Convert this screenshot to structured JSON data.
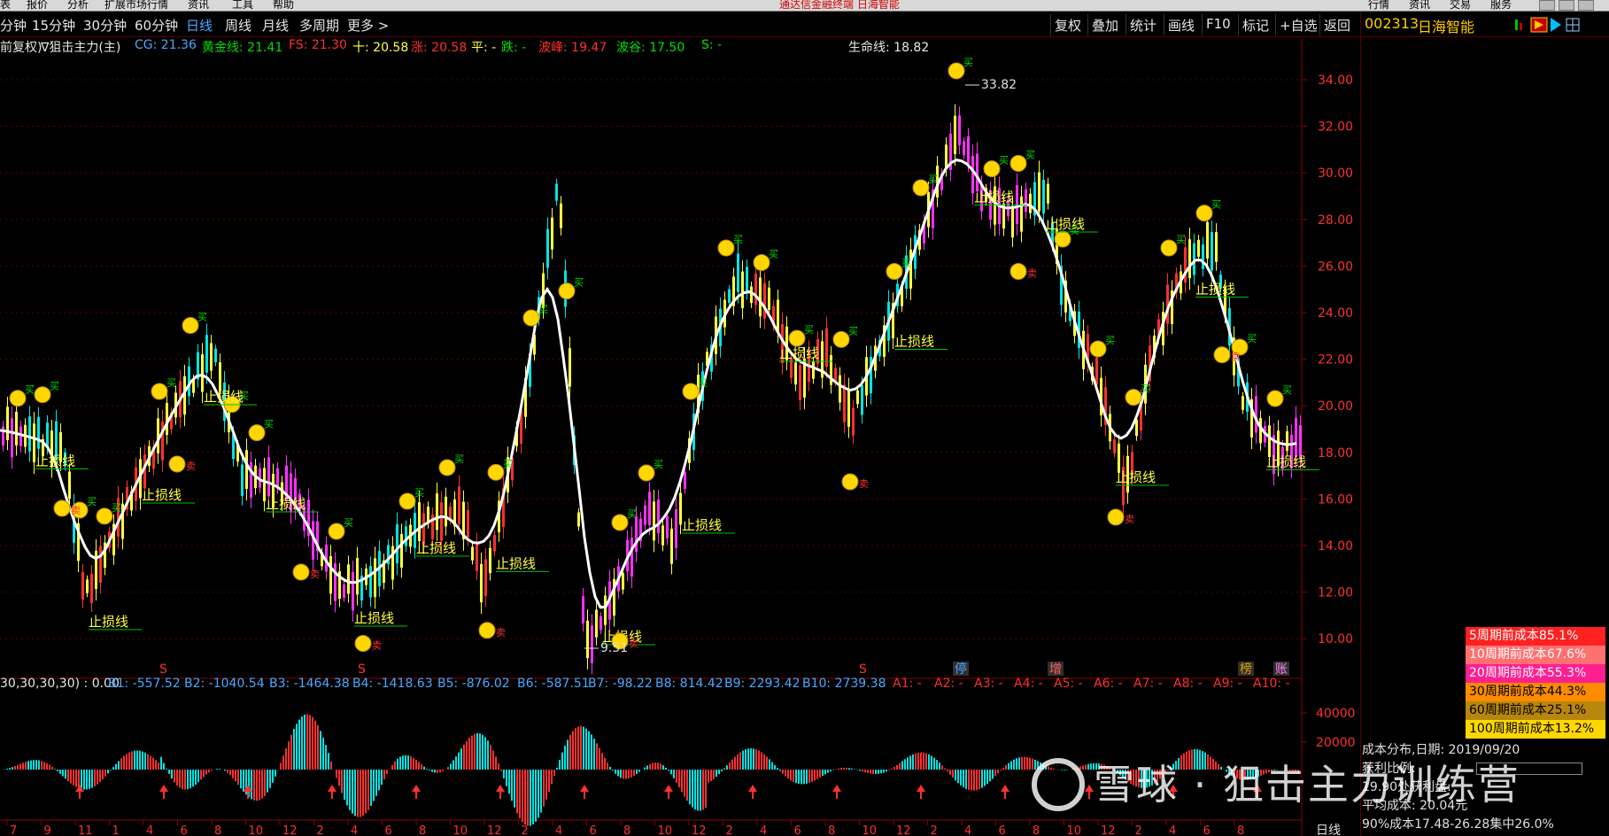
{
  "menu": {
    "items": [
      "表",
      "报价",
      "分析",
      "扩展市场行情",
      "资讯",
      "工具",
      "帮助"
    ],
    "app_title": "通达信金融终端 日海智能",
    "right_items": [
      "行情",
      "资讯",
      "交易",
      "服务"
    ]
  },
  "periods": {
    "items": [
      "分钟",
      "15分钟",
      "30分钟",
      "60分钟",
      "日线",
      "周线",
      "月线",
      "多周期",
      "更多 >"
    ],
    "active": "日线"
  },
  "toolbar": [
    "复权",
    "叠加",
    "统计",
    "画线",
    "F10",
    "标记",
    "+自选",
    "返回"
  ],
  "stock": {
    "code": "002313",
    "name": "日海智能"
  },
  "indicator": {
    "mode": "前复权",
    "name": "∇狙击主力(主)",
    "values": [
      {
        "label": "CG: 21.36",
        "color": "#4aa8ff"
      },
      {
        "label": "黄金线: 21.41",
        "color": "#00e000"
      },
      {
        "label": "FS: 21.30",
        "color": "#ff3030"
      },
      {
        "label": "十: 20.58",
        "color": "#ffff40"
      },
      {
        "label": "涨: 20.58",
        "color": "#ff3030"
      },
      {
        "label": "平: -",
        "color": "#ffff40"
      },
      {
        "label": "跌: -",
        "color": "#00e000"
      },
      {
        "label": "波峰: 19.47",
        "color": "#ff3030"
      },
      {
        "label": "波谷: 17.50",
        "color": "#00e000"
      },
      {
        "label": "S: -",
        "color": "#00e000"
      }
    ],
    "lifeline": "生命线: 18.82"
  },
  "price_axis": [
    "34.00",
    "32.00",
    "30.00",
    "28.00",
    "26.00",
    "24.00",
    "22.00",
    "20.00",
    "18.00",
    "16.00",
    "14.00",
    "12.00",
    "10.00"
  ],
  "annotations": {
    "high": "33.82",
    "low": "9.51",
    "stop_loss": "止损线",
    "sell": "卖",
    "buy": "买"
  },
  "event_markers": [
    "S",
    "S",
    "S",
    "停",
    "增",
    "榜",
    "账"
  ],
  "oscillator": {
    "params": "30,30,30,30) : 0.00",
    "values": [
      {
        "label": "B1: -557.52",
        "color": "#4aa8ff"
      },
      {
        "label": "B2: -1040.54",
        "color": "#4aa8ff"
      },
      {
        "label": "B3: -1464.38",
        "color": "#4aa8ff"
      },
      {
        "label": "B4: -1418.63",
        "color": "#4aa8ff"
      },
      {
        "label": "B5: -876.02",
        "color": "#4aa8ff"
      },
      {
        "label": "B6: -587.51",
        "color": "#4aa8ff"
      },
      {
        "label": "B7: -98.22",
        "color": "#4aa8ff"
      },
      {
        "label": "B8: 814.42",
        "color": "#4aa8ff"
      },
      {
        "label": "B9: 2293.42",
        "color": "#4aa8ff"
      },
      {
        "label": "B10: 2739.38",
        "color": "#4aa8ff"
      },
      {
        "label": "A1: -",
        "color": "#ff3030"
      },
      {
        "label": "A2: -",
        "color": "#ff3030"
      },
      {
        "label": "A3: -",
        "color": "#ff3030"
      },
      {
        "label": "A4: -",
        "color": "#ff3030"
      },
      {
        "label": "A5: -",
        "color": "#ff3030"
      },
      {
        "label": "A6: -",
        "color": "#ff3030"
      },
      {
        "label": "A7: -",
        "color": "#ff3030"
      },
      {
        "label": "A8: -",
        "color": "#ff3030"
      },
      {
        "label": "A9: -",
        "color": "#ff3030"
      },
      {
        "label": "A10: -",
        "color": "#ff3030"
      }
    ],
    "axis": [
      "40000",
      "20000"
    ]
  },
  "date_axis": [
    "7",
    "9",
    "11",
    "1",
    "4",
    "6",
    "8",
    "10",
    "12",
    "2",
    "4",
    "6",
    "8",
    "10",
    "12",
    "2",
    "4",
    "6",
    "8",
    "10",
    "12",
    "2",
    "4",
    "6",
    "8",
    "10",
    "12",
    "2",
    "4",
    "6",
    "8",
    "10",
    "12",
    "2",
    "4",
    "6",
    "8"
  ],
  "timeframe_label": "日线",
  "cost_legend": [
    {
      "label": "5周期前成本85.1%",
      "bg": "#ff2020",
      "color": "#ffffff"
    },
    {
      "label": "10周期前成本67.6%",
      "bg": "#ff7070",
      "color": "#ffffff"
    },
    {
      "label": "20周期前成本55.3%",
      "bg": "#ff1e90",
      "color": "#ffffff"
    },
    {
      "label": "30周期前成本44.3%",
      "bg": "#ff8c00",
      "color": "#000000"
    },
    {
      "label": "60周期前成本25.1%",
      "bg": "#b8860b",
      "color": "#000000"
    },
    {
      "label": "100周期前成本13.2%",
      "bg": "#ffd700",
      "color": "#000000"
    }
  ],
  "cost_info": {
    "date": "成本分布,日期: 2019/09/20",
    "profit": "获利比例: ",
    "profit_at": "19.90处获利盘: ",
    "avg": "平均成本: 20.04元",
    "range": "90%成本17.48-26.28集中26.0%"
  },
  "watermark": "雪球 · 狙击主力训练营"
}
